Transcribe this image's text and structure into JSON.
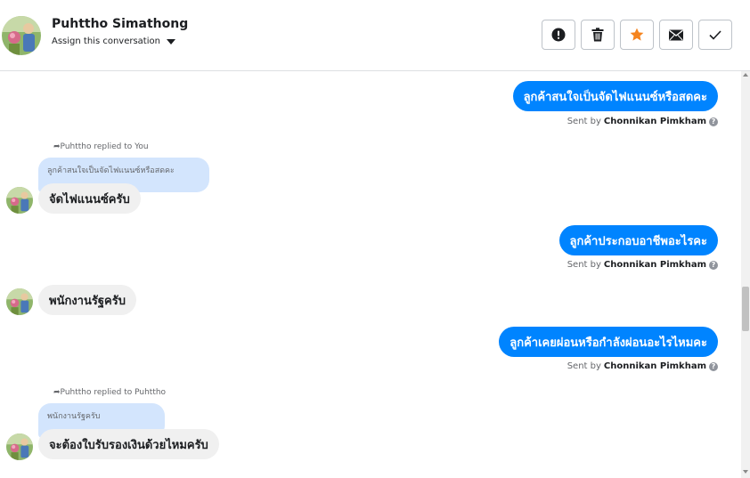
{
  "header": {
    "contact_name": "Puhttho Simathong",
    "assign_label": "Assign this conversation",
    "actions": [
      {
        "name": "spam",
        "icon": "exclamation-icon"
      },
      {
        "name": "delete",
        "icon": "trash-icon"
      },
      {
        "name": "star",
        "icon": "star-icon",
        "color": "#f5841f"
      },
      {
        "name": "mark-unread",
        "icon": "envelope-icon"
      },
      {
        "name": "done",
        "icon": "check-icon"
      }
    ]
  },
  "thread": {
    "messages": [
      {
        "direction": "out",
        "text": "ลูกค้าสนใจเป็นจัดไฟแนนซ์หรือสดคะ",
        "sent_by_prefix": "Sent by",
        "sender": "Chonnikan Pimkham"
      },
      {
        "direction": "in",
        "reply_note": "Puhttho replied to You",
        "quoted": "ลูกค้าสนใจเป็นจัดไฟแนนซ์หรือสดคะ",
        "text": "จัดไฟแนนซ์ครับ"
      },
      {
        "direction": "out",
        "text": "ลูกค้าประกอบอาชีพอะไรคะ",
        "sent_by_prefix": "Sent by",
        "sender": "Chonnikan Pimkham"
      },
      {
        "direction": "in",
        "text": "พนักงานรัฐครับ"
      },
      {
        "direction": "out",
        "text": "ลูกค้าเคยผ่อนหรือกำลังผ่อนอะไรไหมคะ",
        "sent_by_prefix": "Sent by",
        "sender": "Chonnikan Pimkham"
      },
      {
        "direction": "in",
        "reply_note": "Puhttho replied to Puhttho",
        "quoted": "พนักงานรัฐครับ",
        "text": "จะต้องใบรับรองเงินด้วยไหมครับ"
      }
    ]
  },
  "colors": {
    "outgoing_bubble": "#0084ff",
    "incoming_bubble": "#f0f0f0",
    "quoted_bubble": "#d3e5fd",
    "star": "#f5841f"
  }
}
